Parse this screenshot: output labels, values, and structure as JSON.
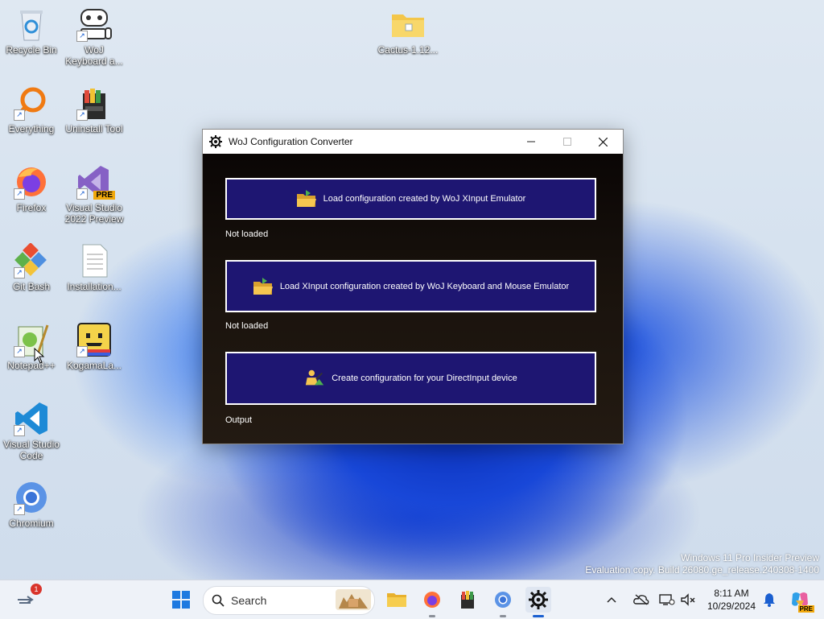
{
  "desktop": {
    "icons": [
      {
        "label": "Recycle Bin"
      },
      {
        "label": "WoJ Keyboard a..."
      },
      {
        "label": "Cactus-1.12..."
      },
      {
        "label": "Everything"
      },
      {
        "label": "Uninstall Tool"
      },
      {
        "label": "Firefox"
      },
      {
        "label": "Visual Studio 2022 Preview"
      },
      {
        "label": "Git Bash"
      },
      {
        "label": "Installation..."
      },
      {
        "label": "Notepad++"
      },
      {
        "label": "KogamaLa..."
      },
      {
        "label": "Visual Studio Code"
      },
      {
        "label": "Chromium"
      }
    ],
    "vs_badge": "PRE",
    "watermark_line1": "Windows 11 Pro Insider Preview",
    "watermark_line2": "Evaluation copy. Build 26080.ge_release.240308-1400"
  },
  "window": {
    "title": "WoJ Configuration Converter",
    "buttons": [
      {
        "label": "Load configuration created by WoJ XInput Emulator",
        "icon": "folder-open-icon"
      },
      {
        "label": "Load XInput configuration created by WoJ Keyboard and Mouse Emulator",
        "icon": "folder-open-icon"
      },
      {
        "label": "Create configuration for your DirectInput device",
        "icon": "construction-worker-icon"
      }
    ],
    "statuses": [
      "Not loaded",
      "Not loaded",
      "Output"
    ]
  },
  "taskbar": {
    "search_placeholder": "Search",
    "notification_count": "1",
    "clock_time": "8:11 AM",
    "clock_date": "10/29/2024",
    "copilot_badge": "PRE"
  }
}
